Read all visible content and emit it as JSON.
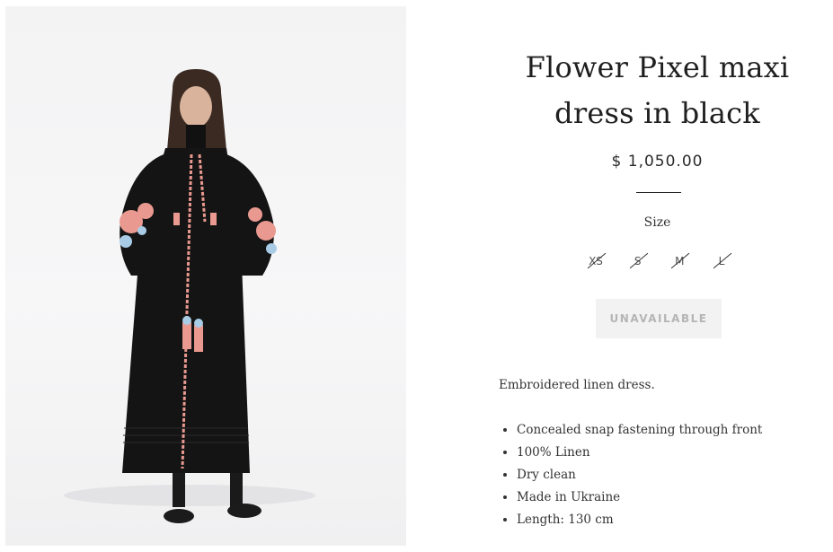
{
  "product": {
    "title_line1": "Flower Pixel maxi",
    "title_line2": "dress in black",
    "price": "$ 1,050.00",
    "size_label": "Size",
    "sizes": [
      "XS",
      "S",
      "M",
      "L"
    ],
    "button_label": "UNAVAILABLE",
    "description": "Embroidered linen dress.",
    "features": [
      "Concealed snap fastening through front",
      "100% Linen",
      "Dry clean",
      "Made in Ukraine",
      "Length: 130 cm"
    ]
  },
  "colors": {
    "dress": "#141414",
    "embroidery_pink": "#e9998f",
    "embroidery_blue": "#a9cce6",
    "button_bg": "#f2f2f2",
    "button_text": "#b5b5b5"
  }
}
